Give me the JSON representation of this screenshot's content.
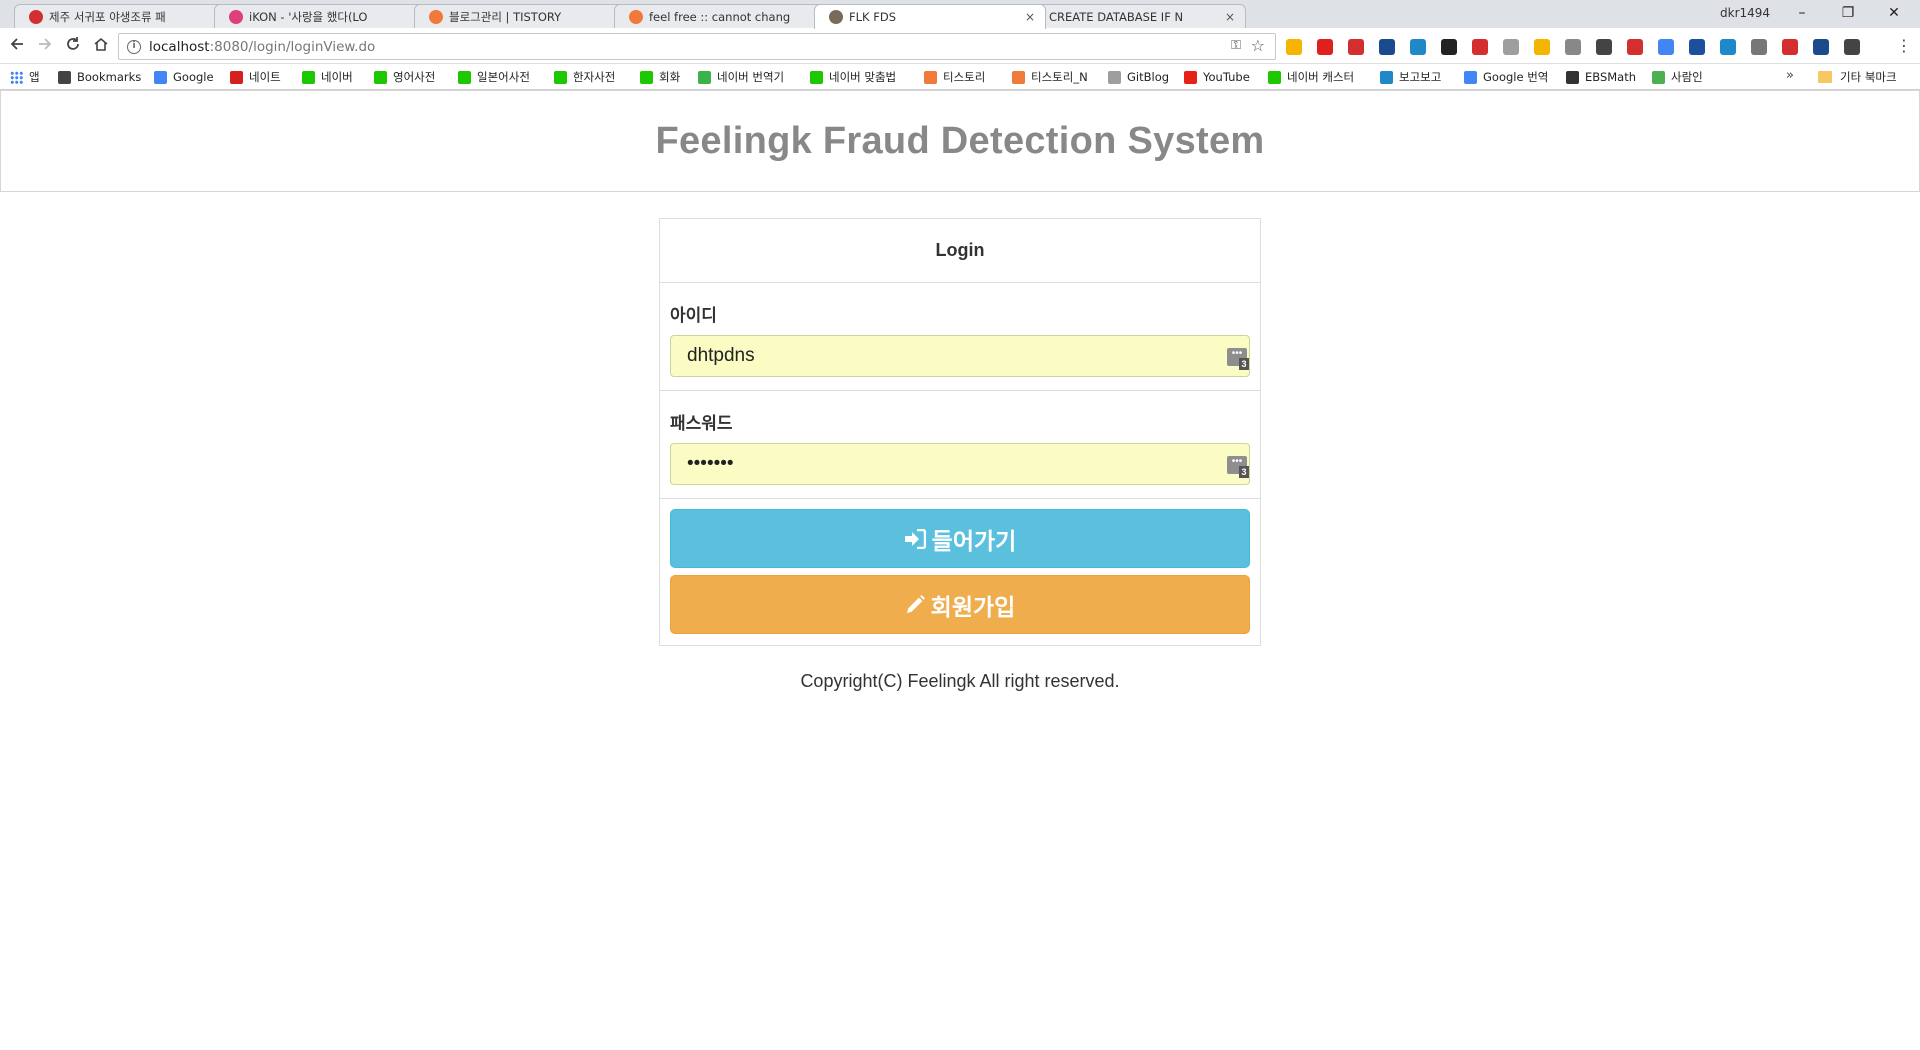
{
  "browser": {
    "tabs": [
      {
        "title": "제주 서귀포 야생조류 패",
        "color": "#d23030"
      },
      {
        "title": "iKON - '사랑을 했다(LO",
        "color": "#e0407a"
      },
      {
        "title": "블로그관리 | TISTORY",
        "color": "#f07a3a"
      },
      {
        "title": "feel free :: cannot chang",
        "color": "#f07a3a"
      },
      {
        "title": "FLK FDS",
        "color": "#7a6a5a"
      },
      {
        "title": "CREATE DATABASE IF N",
        "color": "#4285f4"
      }
    ],
    "active_tab_index": 4,
    "close_glyph": "×",
    "user_name": "dkr1494",
    "url_host": "localhost",
    "url_path": ":8080/login/loginView.do",
    "window_controls": {
      "minimize": "–",
      "restore": "❐",
      "close": "✕"
    }
  },
  "bookmarks": [
    {
      "label": "앱",
      "icon": "apps-grid-icon",
      "color": "#4285f4"
    },
    {
      "label": "Bookmarks",
      "icon": "star-icon",
      "color": "#444444"
    },
    {
      "label": "Google",
      "icon": "google-icon",
      "color": "#4285f4"
    },
    {
      "label": "네이트",
      "icon": "nate-icon",
      "color": "#d62020"
    },
    {
      "label": "네이버",
      "icon": "naver-icon",
      "color": "#1ec800"
    },
    {
      "label": "영어사전",
      "icon": "dict-icon",
      "color": "#1ec800"
    },
    {
      "label": "일본어사전",
      "icon": "dict-icon",
      "color": "#1ec800"
    },
    {
      "label": "한자사전",
      "icon": "dict-icon",
      "color": "#1ec800"
    },
    {
      "label": "회화",
      "icon": "dict-icon",
      "color": "#1ec800"
    },
    {
      "label": "네이버 번역기",
      "icon": "papago-icon",
      "color": "#3cb34a"
    },
    {
      "label": "네이버 맞춤법",
      "icon": "naver-icon",
      "color": "#1ec800"
    },
    {
      "label": "티스토리",
      "icon": "tistory-icon",
      "color": "#f07a3a"
    },
    {
      "label": "티스토리_N",
      "icon": "tistory-icon",
      "color": "#f07a3a"
    },
    {
      "label": "GitBlog",
      "icon": "document-icon",
      "color": "#9e9e9e"
    },
    {
      "label": "YouTube",
      "icon": "youtube-icon",
      "color": "#e62117"
    },
    {
      "label": "네이버 캐스터",
      "icon": "play-icon",
      "color": "#1ec800"
    },
    {
      "label": "보고보고",
      "icon": "bogo-icon",
      "color": "#1e88c8"
    },
    {
      "label": "Google 번역",
      "icon": "translate-icon",
      "color": "#4285f4"
    },
    {
      "label": "EBSMath",
      "icon": "ebsmath-icon",
      "color": "#333333"
    },
    {
      "label": "사람인",
      "icon": "saramin-icon",
      "color": "#4caf50"
    }
  ],
  "bookmarks_more": "»",
  "bookmarks_other": "기타 북마크",
  "extensions": [
    {
      "icon": "crown-ext-icon",
      "color": "#f4b400"
    },
    {
      "icon": "opera-ext-icon",
      "color": "#e0201e"
    },
    {
      "icon": "adblock-ext-icon",
      "color": "#d32f2f"
    },
    {
      "icon": "vimeo-ext-icon",
      "color": "#1a4b8c"
    },
    {
      "icon": "globe-ext-icon",
      "color": "#1e88c8"
    },
    {
      "icon": "kindle-ext-icon",
      "color": "#222222"
    },
    {
      "icon": "forward-ext-icon",
      "color": "#d32f2f"
    },
    {
      "icon": "screen-ext-icon",
      "color": "#9e9e9e"
    },
    {
      "icon": "folder-ext-icon",
      "color": "#f4b400"
    },
    {
      "icon": "notion-ext-icon",
      "color": "#888888"
    },
    {
      "icon": "pocket-ext-icon",
      "color": "#444444"
    },
    {
      "icon": "mail-ext-icon",
      "color": "#d32f2f"
    },
    {
      "icon": "translate-ext-icon",
      "color": "#4285f4"
    },
    {
      "icon": "hanja-ext-icon",
      "color": "#1e4e9e"
    },
    {
      "icon": "sync-ext-icon",
      "color": "#1e88c8"
    },
    {
      "icon": "camera-ext-icon",
      "color": "#777777"
    },
    {
      "icon": "bookmark-ext-icon",
      "color": "#d32f2f"
    },
    {
      "icon": "block-ext-icon",
      "color": "#1a4b8c"
    },
    {
      "icon": "window-ext-icon",
      "color": "#444444"
    }
  ],
  "page": {
    "title": "Feelingk Fraud Detection System",
    "panel_heading": "Login",
    "id_label": "아이디",
    "id_value": "dhtpdns",
    "password_label": "패스워드",
    "password_value": "•••••••",
    "autofill_count": "3",
    "login_button": "들어가기",
    "signup_button": "회원가입",
    "footer": "Copyright(C) Feelingk All right reserved."
  },
  "colors": {
    "title_gray": "#888888",
    "login_button": "#5bc0de",
    "signup_button": "#f0ad4e",
    "autofill_bg": "#fafcc4"
  }
}
